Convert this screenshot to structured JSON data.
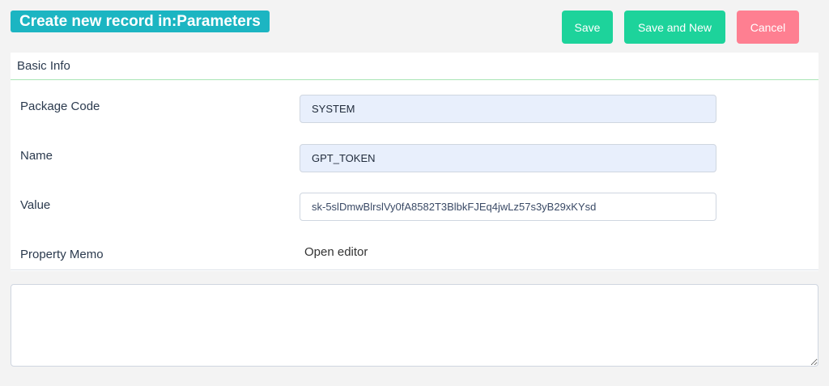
{
  "header": {
    "title": "Create new record in:Parameters",
    "save_label": "Save",
    "save_new_label": "Save and New",
    "cancel_label": "Cancel"
  },
  "colors": {
    "title_bg": "#1cb5c2",
    "save": "#1dd39b",
    "cancel": "#fe7f91",
    "filled_input_bg": "#e8effc"
  },
  "section": {
    "title": "Basic Info",
    "fields": [
      {
        "label": "Package Code",
        "value": "SYSTEM"
      },
      {
        "label": "Name",
        "value": "GPT_TOKEN"
      },
      {
        "label": "Value",
        "value": "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"
      },
      {
        "label": "Property Memo",
        "action": "Open editor"
      }
    ]
  },
  "memo": {
    "value": ""
  }
}
